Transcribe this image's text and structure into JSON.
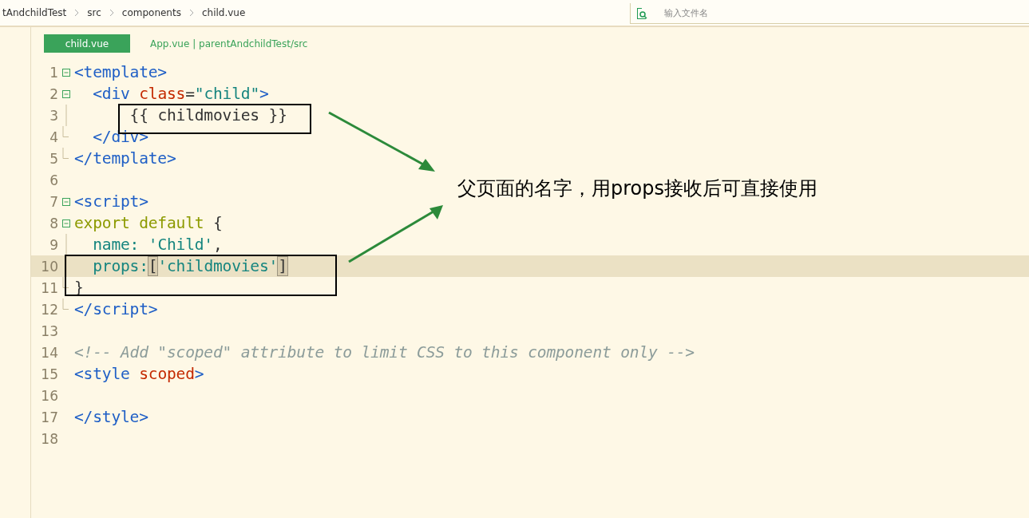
{
  "breadcrumb": [
    "tAndchildTest",
    "src",
    "components",
    "child.vue"
  ],
  "search": {
    "placeholder": "输入文件名"
  },
  "tabs": [
    {
      "label": "child.vue",
      "selected": true
    },
    {
      "label": "App.vue | parentAndchildTest/src",
      "selected": false
    }
  ],
  "code_lines": [
    {
      "number": "1",
      "kind": "start",
      "highlighted": false,
      "tokens": [
        {
          "kind": "tag",
          "text": "<template>"
        }
      ]
    },
    {
      "number": "2",
      "kind": "start",
      "highlighted": false,
      "tokens": [
        {
          "kind": "tag",
          "text": "  <div"
        },
        {
          "kind": "attr",
          "text": " class"
        },
        {
          "kind": "plain",
          "text": "="
        },
        {
          "kind": "string",
          "text": "\"child\""
        },
        {
          "kind": "tag",
          "text": ">"
        }
      ]
    },
    {
      "number": "3",
      "kind": "inner",
      "highlighted": false,
      "tokens": [
        {
          "kind": "plain",
          "text": "      {{ childmovies }}"
        }
      ]
    },
    {
      "number": "4",
      "kind": "end",
      "highlighted": false,
      "tokens": [
        {
          "kind": "tag",
          "text": "  </div>"
        }
      ]
    },
    {
      "number": "5",
      "kind": "end",
      "highlighted": false,
      "tokens": [
        {
          "kind": "tag",
          "text": "</template>"
        }
      ]
    },
    {
      "number": "6",
      "kind": "plain",
      "highlighted": false
    },
    {
      "number": "7",
      "kind": "start",
      "highlighted": false,
      "tokens": [
        {
          "kind": "tag",
          "text": "<script>"
        }
      ]
    },
    {
      "number": "8",
      "kind": "start",
      "highlighted": false,
      "tokens": [
        {
          "kind": "keyword",
          "text": "export default"
        },
        {
          "kind": "plain",
          "text": " {"
        }
      ]
    },
    {
      "number": "9",
      "kind": "inner",
      "highlighted": false,
      "tokens": [
        {
          "kind": "key",
          "text": "  name:"
        },
        {
          "kind": "string",
          "text": " 'Child'"
        },
        {
          "kind": "plain",
          "text": ","
        }
      ]
    },
    {
      "number": "10",
      "kind": "inner",
      "highlighted": true,
      "tokens": [
        {
          "kind": "key",
          "text": "  props:"
        },
        {
          "kind": "match",
          "text": "["
        },
        {
          "kind": "string",
          "text": "'childmovies'"
        },
        {
          "kind": "match",
          "text": "]"
        }
      ]
    },
    {
      "number": "11",
      "kind": "end",
      "highlighted": false,
      "tokens": [
        {
          "kind": "plain",
          "text": "}"
        }
      ]
    },
    {
      "number": "12",
      "kind": "end",
      "highlighted": false,
      "tokens": [
        {
          "kind": "tag",
          "text": "</script>"
        }
      ]
    },
    {
      "number": "13",
      "kind": "plain",
      "highlighted": false
    },
    {
      "number": "14",
      "kind": "plain",
      "highlighted": false,
      "tokens": [
        {
          "kind": "comment",
          "text": "<!-- Add \"scoped\" attribute to limit CSS to this component only -->"
        }
      ]
    },
    {
      "number": "15",
      "kind": "plain",
      "highlighted": false,
      "tokens": [
        {
          "kind": "tag",
          "text": "<style"
        },
        {
          "kind": "attr",
          "text": " scoped"
        },
        {
          "kind": "tag",
          "text": ">"
        }
      ]
    },
    {
      "number": "16",
      "kind": "plain",
      "highlighted": false
    },
    {
      "number": "17",
      "kind": "plain",
      "highlighted": false,
      "tokens": [
        {
          "kind": "tag",
          "text": "</style>"
        }
      ]
    },
    {
      "number": "18",
      "kind": "plain",
      "highlighted": false
    }
  ],
  "annotation": {
    "caption": "父页面的名字，用props接收后可直接使用"
  }
}
